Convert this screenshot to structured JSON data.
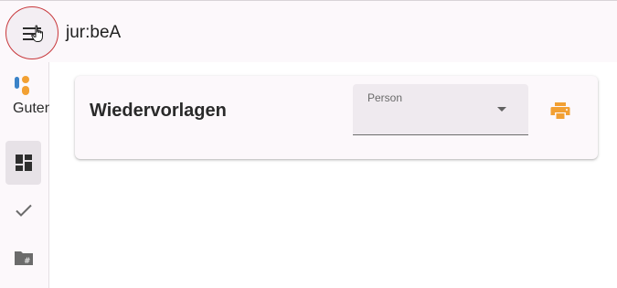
{
  "header": {
    "title": "jur:beA"
  },
  "sidebar": {
    "brand_label": "Guten"
  },
  "card": {
    "title": "Wiedervorlagen"
  },
  "person_select": {
    "label": "Person",
    "value": ""
  },
  "colors": {
    "accent": "#f2a033",
    "focus_ring": "#c8373b"
  },
  "icons": [
    "menu-icon",
    "hand-cursor-icon",
    "brand-logo",
    "dashboard-icon",
    "check-icon",
    "folder-hash-icon",
    "chevron-down-icon",
    "print-icon"
  ]
}
